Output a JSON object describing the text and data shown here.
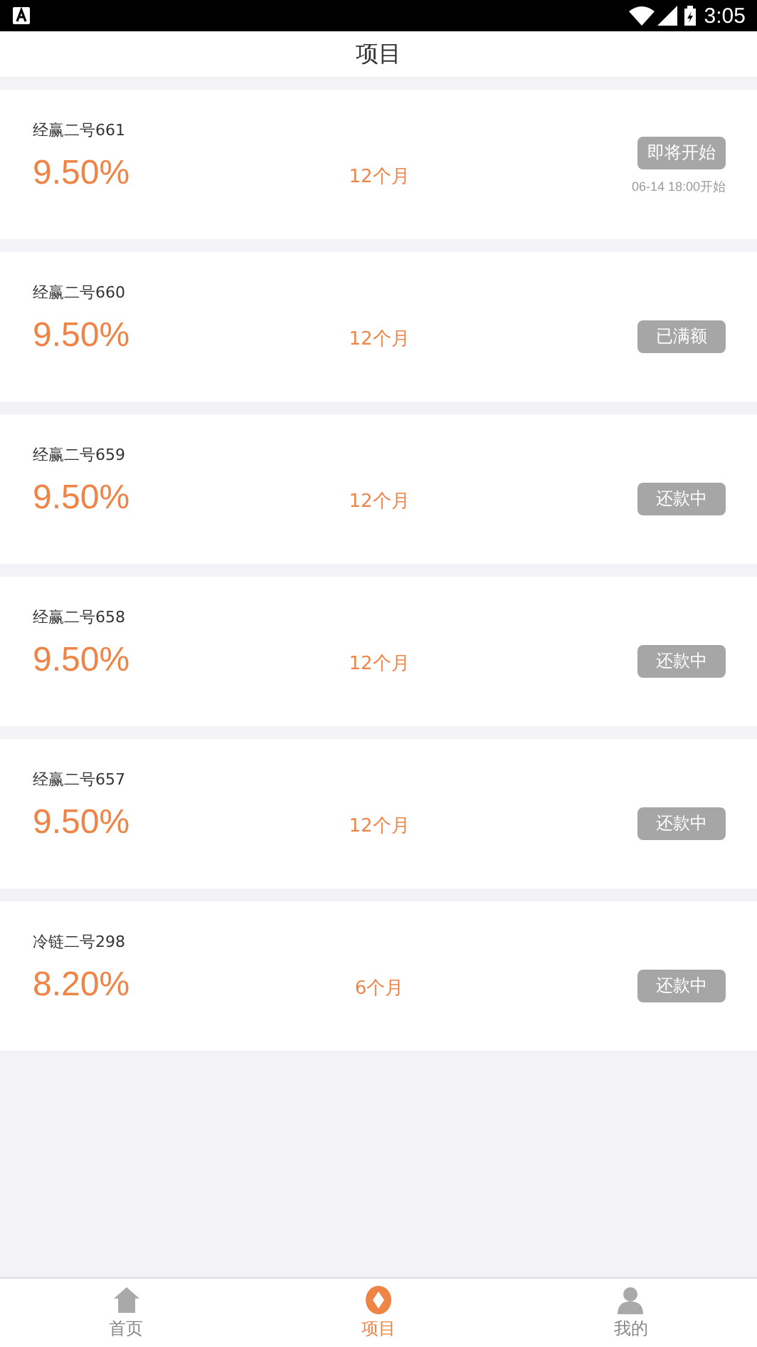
{
  "status_bar": {
    "time": "3:05"
  },
  "header": {
    "title": "项目"
  },
  "products": [
    {
      "name": "经赢二号661",
      "rate": "9.50%",
      "term": "12个月",
      "status": "即将开始",
      "note": "06-14 18:00开始"
    },
    {
      "name": "经赢二号660",
      "rate": "9.50%",
      "term": "12个月",
      "status": "已满额"
    },
    {
      "name": "经赢二号659",
      "rate": "9.50%",
      "term": "12个月",
      "status": "还款中"
    },
    {
      "name": "经赢二号658",
      "rate": "9.50%",
      "term": "12个月",
      "status": "还款中"
    },
    {
      "name": "经赢二号657",
      "rate": "9.50%",
      "term": "12个月",
      "status": "还款中"
    },
    {
      "name": "冷链二号298",
      "rate": "8.20%",
      "term": "6个月",
      "status": "还款中"
    }
  ],
  "tabs": [
    {
      "label": "首页",
      "kind": "home",
      "selected": false
    },
    {
      "label": "项目",
      "kind": "project",
      "selected": true
    },
    {
      "label": "我的",
      "kind": "me",
      "selected": false
    }
  ]
}
